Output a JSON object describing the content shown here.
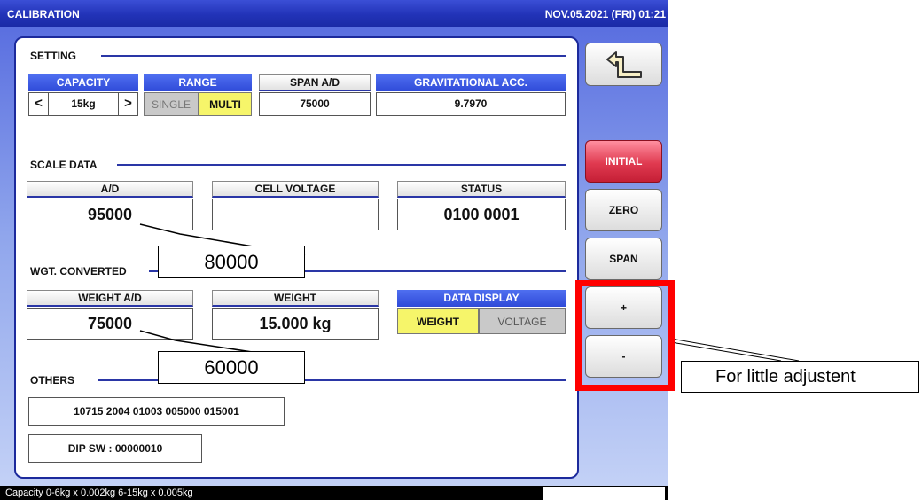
{
  "titlebar": {
    "title": "CALIBRATION",
    "datetime": "NOV.05.2021 (FRI)  01:21"
  },
  "setting": {
    "label": "SETTING",
    "capacity": {
      "header": "CAPACITY",
      "value": "15kg",
      "prev": "<",
      "next": ">"
    },
    "range": {
      "header": "RANGE",
      "single": "SINGLE",
      "multi": "MULTI",
      "selected": "MULTI"
    },
    "span_ad": {
      "header": "SPAN A/D",
      "value": "75000"
    },
    "grav": {
      "header": "GRAVITATIONAL ACC.",
      "value": "9.7970"
    }
  },
  "scale_data": {
    "label": "SCALE DATA",
    "ad": {
      "header": "A/D",
      "value": "95000"
    },
    "cell_voltage": {
      "header": "CELL VOLTAGE",
      "value": ""
    },
    "status": {
      "header": "STATUS",
      "value": "0100 0001"
    }
  },
  "wgt_converted": {
    "label": "WGT. CONVERTED",
    "weight_ad": {
      "header": "WEIGHT A/D",
      "value": "75000"
    },
    "weight": {
      "header": "WEIGHT",
      "value": "15.000 kg"
    },
    "data_display": {
      "header": "DATA DISPLAY",
      "weight": "WEIGHT",
      "voltage": "VOLTAGE",
      "selected": "WEIGHT"
    }
  },
  "others": {
    "label": "OTHERS",
    "line1": "10715 2004 01003 005000 015001",
    "line2": "DIP SW : 00000010"
  },
  "side_buttons": {
    "back_icon": "back-arrow-icon",
    "initial": "INITIAL",
    "zero": "ZERO",
    "span": "SPAN",
    "plus": "+",
    "minus": "-"
  },
  "statusbar": {
    "text": "Capacity 0-6kg x 0.002kg  6-15kg x 0.005kg"
  },
  "annotations": {
    "callout_ad": "80000",
    "callout_weight_ad": "60000",
    "note": "For little adjustent"
  },
  "colors": {
    "title_blue": "#2233b8",
    "header_blue": "#3a55e0",
    "highlight_yellow": "#f6f56a",
    "initial_red": "#e03a50",
    "annotation_red": "#ff0000"
  }
}
